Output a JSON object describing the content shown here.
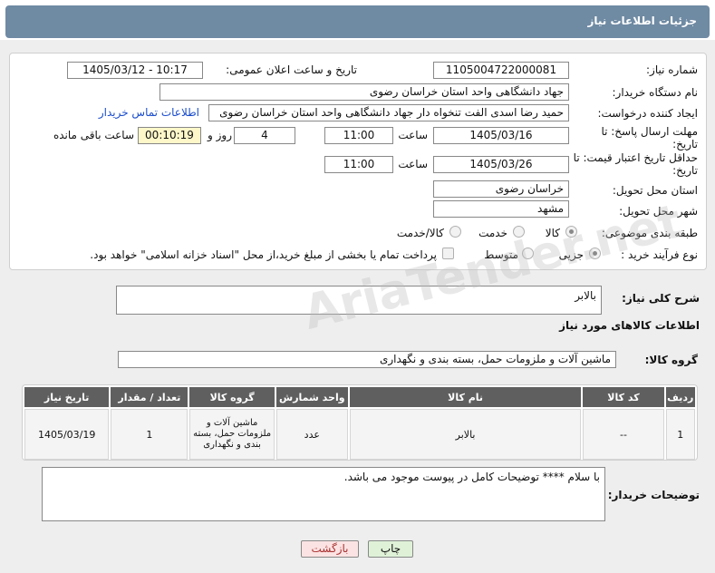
{
  "header": {
    "title": "جزئیات اطلاعات نیاز"
  },
  "fields": {
    "need_number_label": "شماره نیاز:",
    "need_number": "1105004722000081",
    "announce_label": "تاریخ و ساعت اعلان عمومی:",
    "announce_value": "1405/03/12 - 10:17",
    "buyer_org_label": "نام دستگاه خریدار:",
    "buyer_org": "جهاد دانشگاهی واحد استان خراسان رضوی",
    "requester_label": "ایجاد کننده درخواست:",
    "requester": "حمید رضا اسدی الفت تنخواه دار جهاد دانشگاهی واحد استان خراسان رضوی",
    "contact_link": "اطلاعات تماس خریدار",
    "reply_deadline_label": "مهلت ارسال پاسخ: تا تاریخ:",
    "reply_date": "1405/03/16",
    "time_label": "ساعت",
    "reply_time": "11:00",
    "days_value": "4",
    "days_label": "روز و",
    "remaining_value": "00:10:19",
    "remaining_label": "ساعت باقی مانده",
    "validity_label": "حداقل تاریخ اعتبار قیمت: تا تاریخ:",
    "validity_date": "1405/03/26",
    "validity_time": "11:00",
    "province_label": "استان محل تحویل:",
    "province": "خراسان رضوی",
    "city_label": "شهر محل تحویل:",
    "city": "مشهد",
    "category_label": "طبقه بندی موضوعی:",
    "category_opt1": "کالا",
    "category_opt2": "خدمت",
    "category_opt3": "کالا/خدمت",
    "process_label": "نوع فرآیند خرید :",
    "process_opt1": "جزیی",
    "process_opt2": "متوسط",
    "payment_note": "پرداخت تمام یا بخشی از مبلغ خرید،از محل \"اسناد خزانه اسلامی\" خواهد بود."
  },
  "summary": {
    "label": "شرح کلی نیاز:",
    "value": "بالابر"
  },
  "goods": {
    "section_title": "اطلاعات کالاهای مورد نیاز",
    "group_label": "گروه کالا:",
    "group_value": "ماشین آلات و ملزومات حمل، بسته بندی و نگهداری",
    "columns": [
      "ردیف",
      "کد کالا",
      "نام کالا",
      "واحد شمارش",
      "گروه کالا",
      "تعداد / مقدار",
      "تاریخ نیاز"
    ],
    "rows": [
      [
        "1",
        "--",
        "بالابر",
        "عدد",
        "ماشین آلات و ملزومات حمل، بسته بندی و نگهداری",
        "1",
        "1405/03/19"
      ]
    ]
  },
  "buyer_notes": {
    "label": "توضیحات خریدار:",
    "value": "با سلام **** توضیحات کامل در پیوست موجود می باشد."
  },
  "buttons": {
    "print": "چاپ",
    "back": "بازگشت"
  },
  "watermark": "AriaTender.net"
}
